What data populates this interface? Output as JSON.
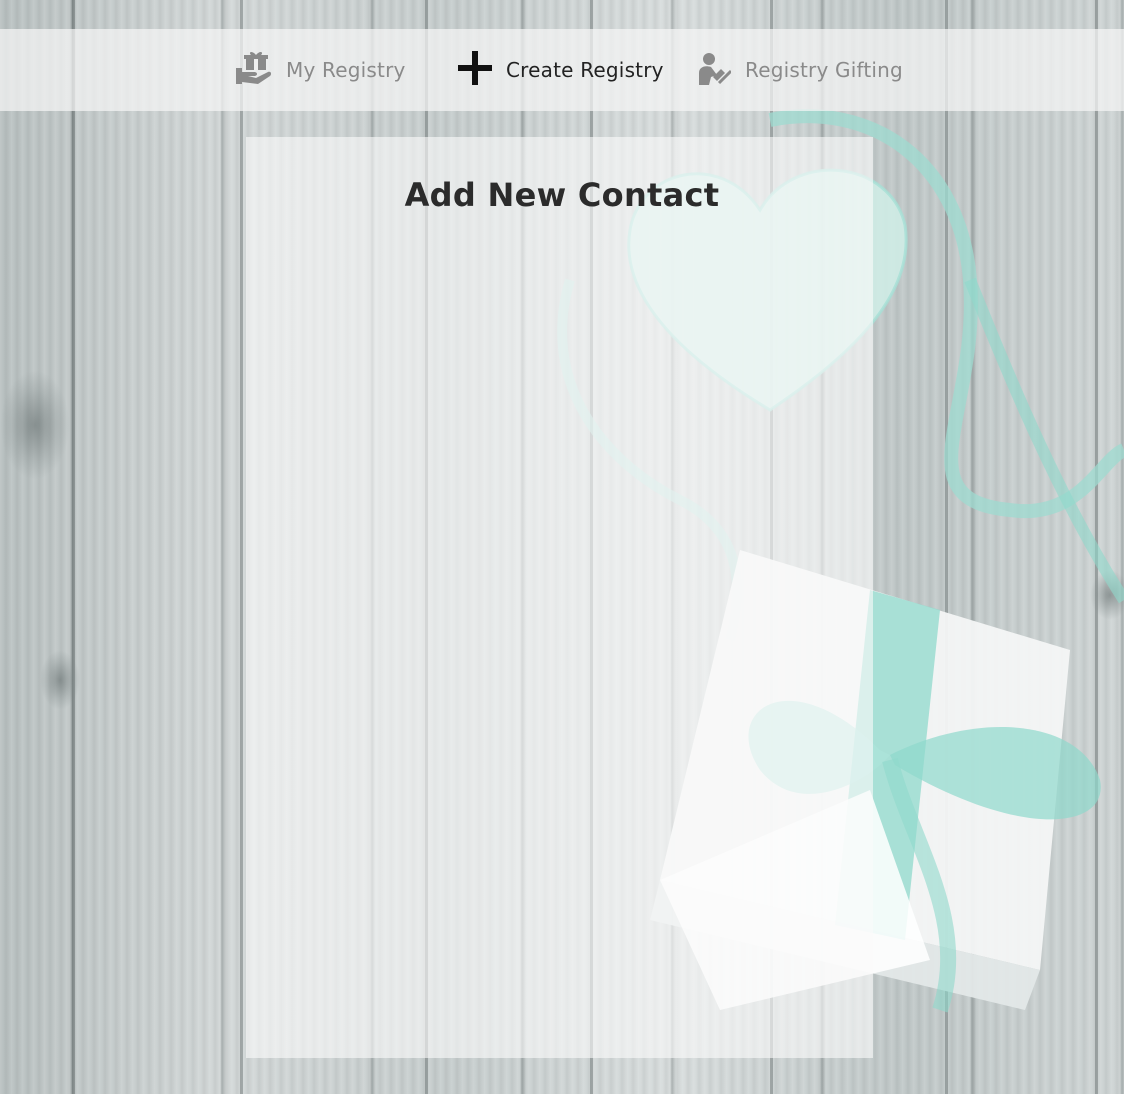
{
  "nav": {
    "items": [
      {
        "label": "My Registry",
        "icon": "gift-in-hand-icon",
        "active": false
      },
      {
        "label": "Create Registry",
        "icon": "plus-icon",
        "active": true
      },
      {
        "label": "Registry Gifting",
        "icon": "person-with-gift-icon",
        "active": false
      }
    ]
  },
  "main": {
    "title": "Add New Contact"
  },
  "colors": {
    "active_text": "#222222",
    "inactive_text": "#8a8a8a",
    "ribbon": "#8fd9cc"
  }
}
